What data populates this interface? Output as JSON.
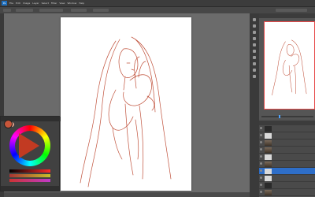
{
  "menu": {
    "logo": "Ps",
    "items": [
      "File",
      "Edit",
      "Image",
      "Layer",
      "Select",
      "Filter",
      "View",
      "Window",
      "Help"
    ]
  },
  "panels": {
    "color_title": "",
    "layers": [
      {
        "label": ""
      },
      {
        "label": ""
      },
      {
        "label": ""
      },
      {
        "label": ""
      },
      {
        "label": ""
      },
      {
        "label": ""
      },
      {
        "label": ""
      },
      {
        "label": ""
      },
      {
        "label": ""
      },
      {
        "label": ""
      }
    ]
  },
  "colors": {
    "foreground": "#c9563a",
    "sketch_line": "#c0503a",
    "active_layer": "#2e6ec8"
  }
}
